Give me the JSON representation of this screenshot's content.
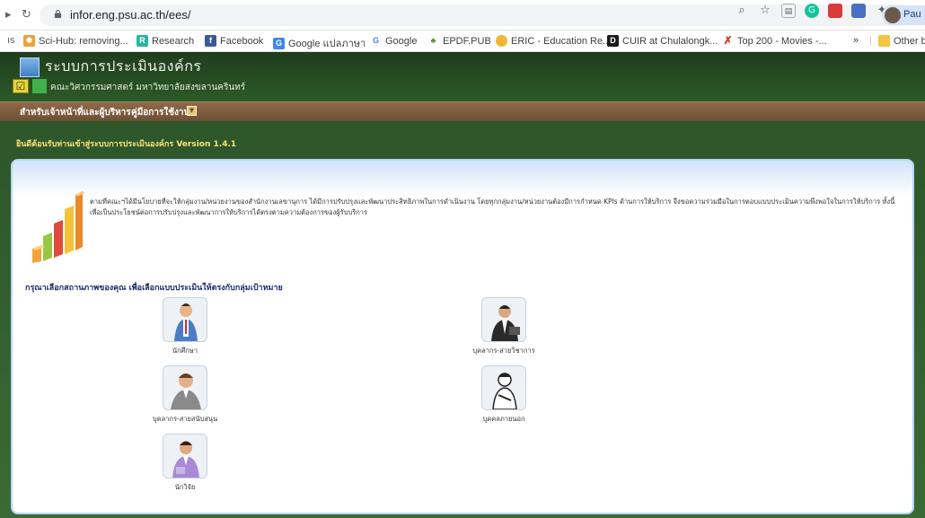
{
  "browser": {
    "url": "infor.eng.psu.ac.th/ees/",
    "profile_name": "Pau",
    "bookmarks": [
      {
        "label": "Sci-Hub: removing...",
        "icon": "scihub-icon"
      },
      {
        "label": "Research",
        "icon": "researchgate-icon"
      },
      {
        "label": "Facebook",
        "icon": "facebook-icon"
      },
      {
        "label": "Google แปลภาษา",
        "icon": "google-translate-icon"
      },
      {
        "label": "Google",
        "icon": "google-icon"
      },
      {
        "label": "EPDF.PUB",
        "icon": "epdf-icon"
      },
      {
        "label": "ERIC - Education Re...",
        "icon": "eric-icon"
      },
      {
        "label": "CUIR at Chulalongk...",
        "icon": "dspace-icon"
      },
      {
        "label": "Top 200 - Movies -...",
        "icon": "x-icon"
      }
    ],
    "more_bookmarks": "»",
    "other_bookmarks": "Other b"
  },
  "site": {
    "title": "ระบบการประเมินองค์กร",
    "subtitle": "คณะวิศวกรรมศาสตร์ มหาวิทยาลัยสงขลานครินทร์",
    "menu": [
      {
        "label": "สำหรับเจ้าหน้าที่และผู้บริหาร"
      },
      {
        "label": "คู่มือการใช้งาน"
      }
    ],
    "welcome": "ยินดีต้อนรับท่านเข้าสู่ระบบการประเมินองค์กร Version 1.4.1",
    "intro": "ตามที่คณะฯได้มีนโยบายที่จะให้กลุ่มงาน/หน่วยงานของสำนักงานเลขานุการ ได้มีการปรับปรุงและพัฒนาประสิทธิภาพในการดำเนินงาน โดยทุกกลุ่มงาน/หน่วยงานต้องมีการกำหนด KPIs ด้านการให้บริการ จึงขอความร่วมมือในการตอบแบบประเมินความพึงพอใจในการให้บริการ ทั้งนี้ เพื่อเป็นประโยชน์ต่อการปรับปรุงและพัฒนาการให้บริการได้ตรงตามความต้องการของผู้รับบริการ",
    "prompt": "กรุณาเลือกสถานภาพของคุณ เพื่อเลือกแบบประเมินให้ตรงกับกลุ่มเป้าหมาย",
    "roles": [
      {
        "label": "นักศึกษา",
        "icon": "student-icon"
      },
      {
        "label": "บุคลากร-สายวิชาการ",
        "icon": "academic-staff-icon"
      },
      {
        "label": "บุคลากร-สายสนับสนุน",
        "icon": "support-staff-icon"
      },
      {
        "label": "บุคคลภายนอก",
        "icon": "external-person-icon"
      },
      {
        "label": "นักวิจัย",
        "icon": "researcher-icon"
      }
    ]
  },
  "colors": {
    "page_green": "#2f5a2c",
    "menu_brown": "#7a5a3d",
    "welcome_yellow": "#f6e37a",
    "prompt_navy": "#1b2c6e"
  }
}
